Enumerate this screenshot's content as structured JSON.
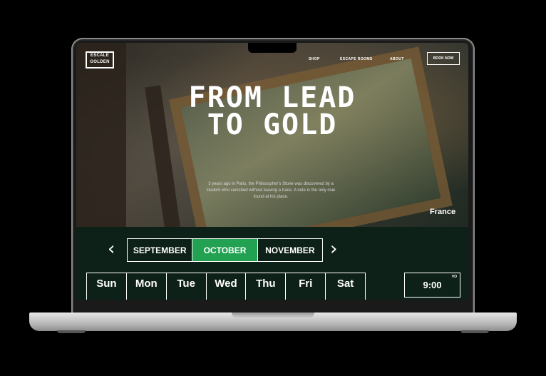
{
  "header": {
    "logo_text_line1": "ESCALE",
    "logo_text_line2": "GOLDEN",
    "nav": [
      "SHOP",
      "ESCAPE ROOMS",
      "ABOUT"
    ],
    "cta": "BOOK NOW"
  },
  "hero": {
    "title": "FROM LEAD\nTO GOLD",
    "description": "3 years ago in Paris, the Philosopher's Stone was discovered by a student who vanished without leaving a trace. A note is the only clue found at his place.",
    "country": "France"
  },
  "calendar": {
    "months": [
      "SEPTEMBER",
      "OCTOBER",
      "NOVEMBER"
    ],
    "active_month": "OCTOBER",
    "weekdays": [
      "Sun",
      "Mon",
      "Tue",
      "Wed",
      "Thu",
      "Fri",
      "Sat"
    ],
    "time_slot": "9:00",
    "time_slot_tag": "VO",
    "prev_icon": "chevron-left-icon",
    "next_icon": "chevron-right-icon"
  },
  "colors": {
    "accent": "#22a152",
    "background": "#0e2119"
  }
}
